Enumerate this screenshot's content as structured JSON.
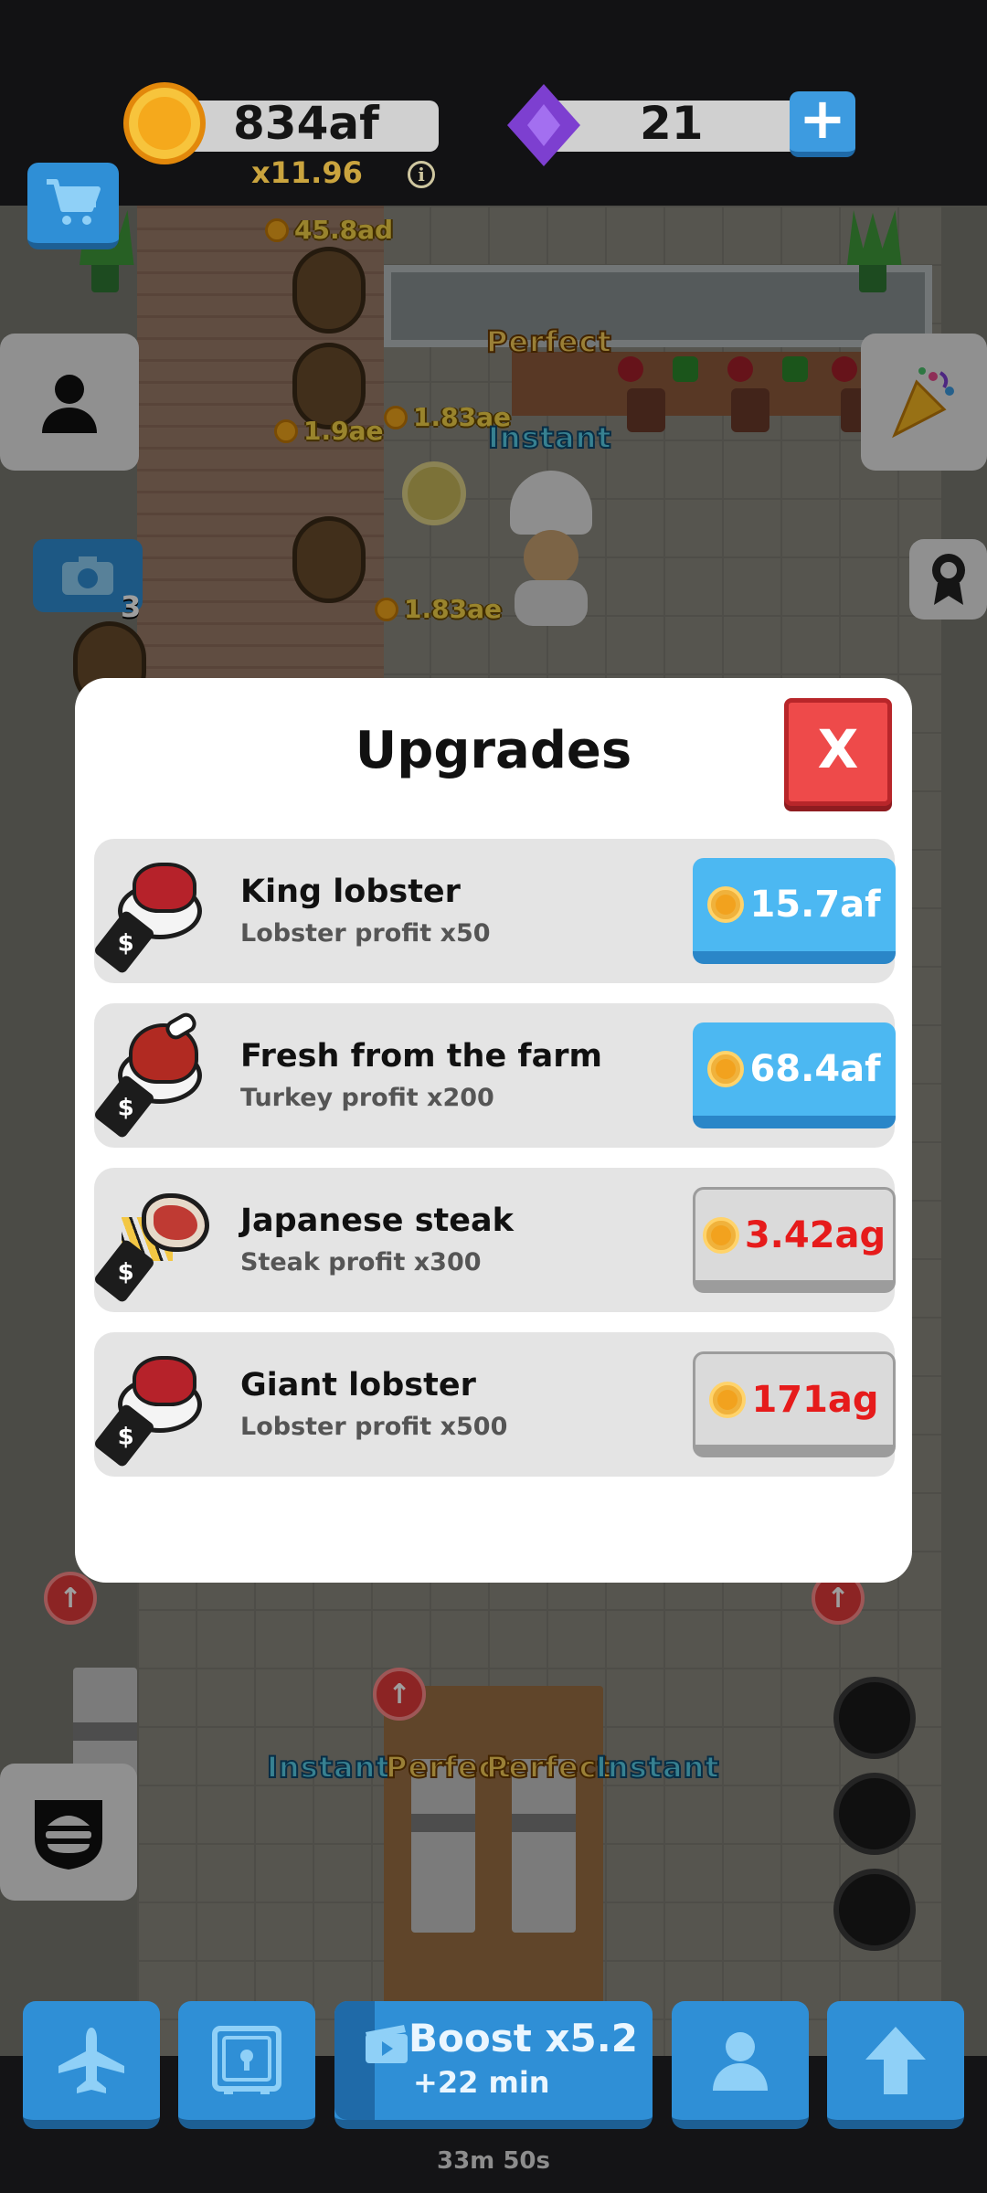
{
  "hud": {
    "coins": "834af",
    "multiplier": "x11.96",
    "info_symbol": "i",
    "gems": "21",
    "plus_symbol": "+"
  },
  "world": {
    "floating": [
      "45.8ad",
      "1.9ae",
      "1.83ae",
      "1.83ae"
    ],
    "combo_top": {
      "perfect": "Perfect",
      "instant": "Instant"
    },
    "combo_bottom": [
      "Instant",
      "Perfect",
      "Perfect",
      "Instant"
    ],
    "queue_count": "3"
  },
  "modal": {
    "title": "Upgrades",
    "close_label": "X",
    "items": [
      {
        "name": "King lobster",
        "desc": "Lobster profit x50",
        "price": "15.7af",
        "state": "affordable",
        "icon": "lobster-dish-icon"
      },
      {
        "name": "Fresh from the farm",
        "desc": "Turkey profit x200",
        "price": "68.4af",
        "state": "affordable",
        "icon": "turkey-dish-icon"
      },
      {
        "name": "Japanese steak",
        "desc": "Steak profit x300",
        "price": "3.42ag",
        "state": "locked",
        "icon": "steak-fries-icon"
      },
      {
        "name": "Giant lobster",
        "desc": "Lobster profit x500",
        "price": "171ag",
        "state": "locked",
        "icon": "lobster-dish-icon"
      }
    ]
  },
  "bottom": {
    "boost_title": "Boost x5.2",
    "boost_sub": "+22 min",
    "timer": "33m 50s",
    "buttons": [
      "airplane-icon",
      "safe-icon",
      "video-boost-icon",
      "manager-icon",
      "arrow-up-icon"
    ]
  },
  "colors": {
    "accent_blue": "#4cb8f2",
    "close_red": "#ee4a4a",
    "price_red": "#e61b1b",
    "coin_gold": "#f5a91c",
    "gem_purple": "#7d3fd0"
  }
}
